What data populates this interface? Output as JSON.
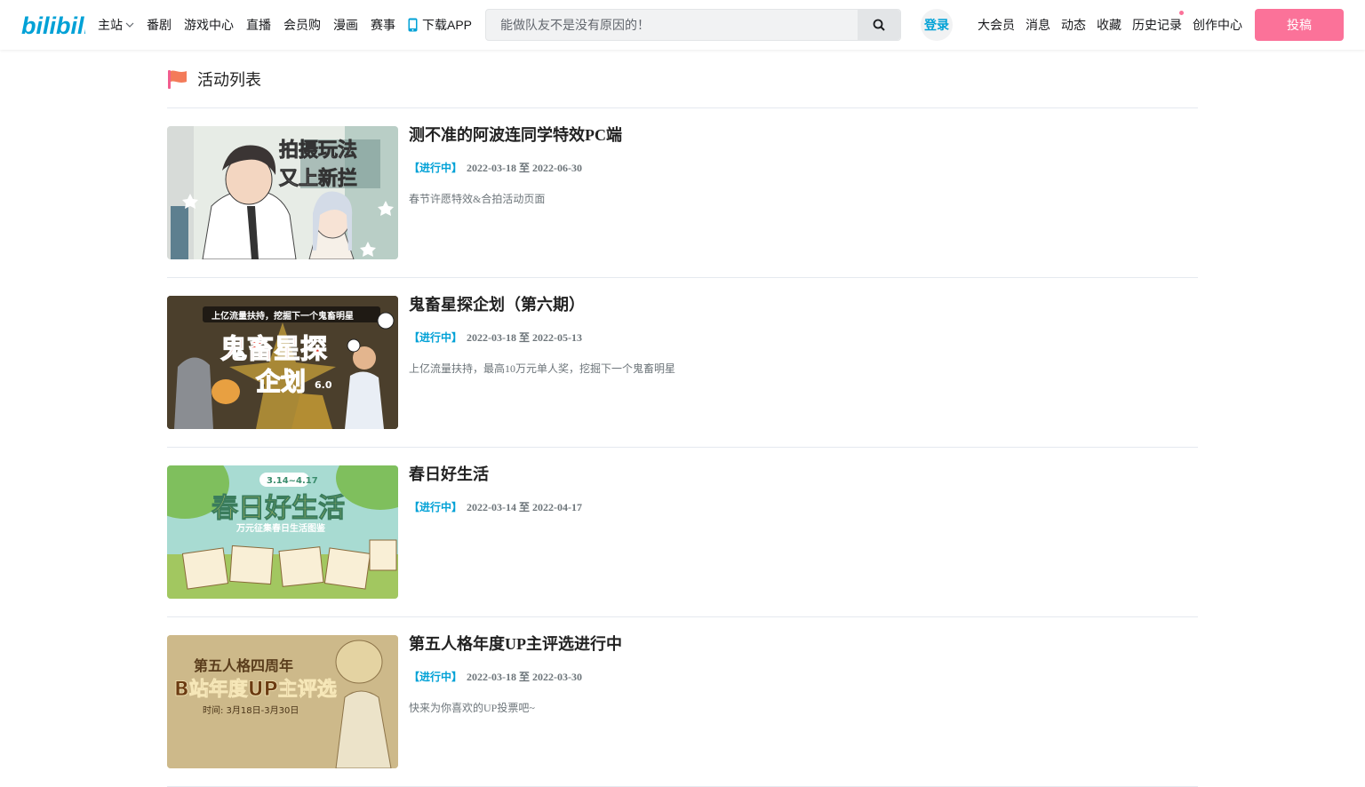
{
  "header": {
    "logo_text": "bilibili",
    "nav_left": [
      "主站",
      "番剧",
      "游戏中心",
      "直播",
      "会员购",
      "漫画",
      "赛事",
      "下载APP"
    ],
    "search_placeholder": "能做队友不是没有原因的！",
    "login": "登录",
    "nav_right": [
      "大会员",
      "消息",
      "动态",
      "收藏",
      "历史记录",
      "创作中心"
    ],
    "upload": "投稿"
  },
  "page": {
    "title": "活动列表"
  },
  "activities": [
    {
      "title": "测不准的阿波连同学特效PC端",
      "status": "【进行中】",
      "start": "2022-03-18",
      "sep": "至",
      "end": "2022-06-30",
      "desc": "春节许愿特效&合拍活动页面",
      "thumb_text": [
        "拍摄玩法",
        "又上新拦"
      ]
    },
    {
      "title": "鬼畜星探企划（第六期）",
      "status": "【进行中】",
      "start": "2022-03-18",
      "sep": "至",
      "end": "2022-05-13",
      "desc": "上亿流量扶持，最高10万元单人奖，挖掘下一个鬼畜明星",
      "thumb_text": [
        "上亿流量扶持，挖掘下一个鬼畜明星",
        "鬼畜星探",
        "企划",
        "6.0"
      ]
    },
    {
      "title": "春日好生活",
      "status": "【进行中】",
      "start": "2022-03-14",
      "sep": "至",
      "end": "2022-04-17",
      "desc": "",
      "thumb_text": [
        "3.14~4.17",
        "春日好生活",
        "万元征集春日生活图鉴"
      ]
    },
    {
      "title": "第五人格年度UP主评选进行中",
      "status": "【进行中】",
      "start": "2022-03-18",
      "sep": "至",
      "end": "2022-03-30",
      "desc": "快来为你喜欢的UP投票吧~",
      "thumb_text": [
        "第五人格四周年",
        "B站年度UP主评选",
        "时间: 3月18日-3月30日"
      ]
    }
  ],
  "colors": {
    "accent": "#00a1d6",
    "pink": "#fb7299",
    "flag": "#f25d8e"
  }
}
